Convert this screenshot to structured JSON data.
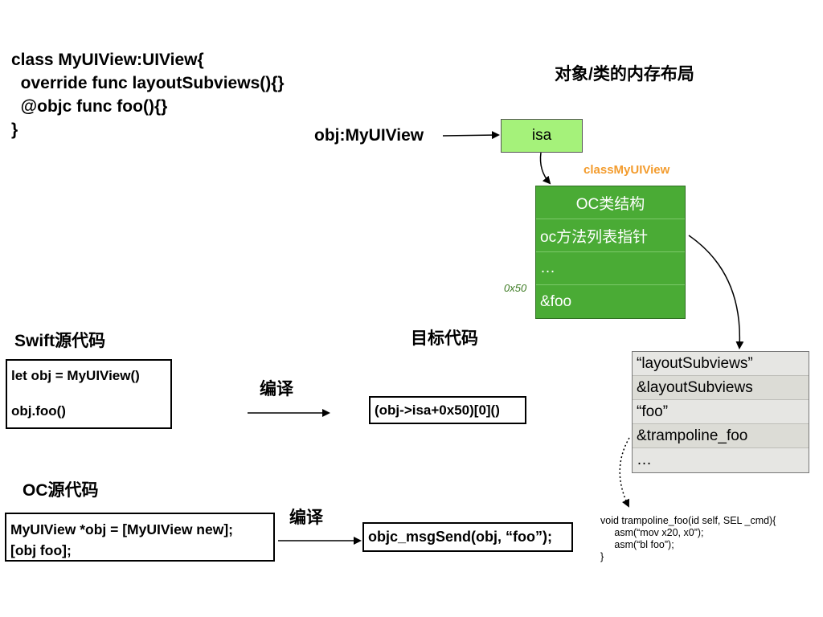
{
  "class_code": {
    "lines": [
      "class MyUIView:UIView{",
      "  override func layoutSubviews(){}",
      "  @objc func foo(){}",
      "}"
    ]
  },
  "memory_layout": {
    "title": "对象/类的内存布局",
    "obj_label": "obj:MyUIView",
    "isa_label": "isa",
    "class_name": "classMyUIView",
    "offset": "0x50",
    "oc_struct_rows": [
      "OC类结构",
      "oc方法列表指针",
      "…",
      "&foo"
    ],
    "method_list_rows": [
      "“layoutSubviews”",
      "&layoutSubviews",
      "“foo”",
      "&trampoline_foo",
      "…"
    ]
  },
  "swift": {
    "title": "Swift源代码",
    "code_lines": [
      "let obj = MyUIView()",
      "",
      "obj.foo()"
    ],
    "compile_label": "编译",
    "target_title": "目标代码",
    "target_code": "(obj->isa+0x50)[0]()"
  },
  "oc": {
    "title": "OC源代码",
    "code_lines": [
      "MyUIView *obj = [MyUIView new];",
      "[obj foo];"
    ],
    "compile_label": "编译",
    "target_code": "objc_msgSend(obj, “foo”);"
  },
  "trampoline_code": {
    "lines": [
      "void trampoline_foo(id self, SEL _cmd){",
      "     asm(“mov x20, x0”);",
      "     asm(“bl foo”);",
      "}"
    ]
  },
  "colors": {
    "isa_fill": "#a5f27a",
    "struct_fill": "#4aab35",
    "class_name": "#f39c2e",
    "offset": "#3c7a22",
    "table_fill": "#e6e6e3"
  }
}
